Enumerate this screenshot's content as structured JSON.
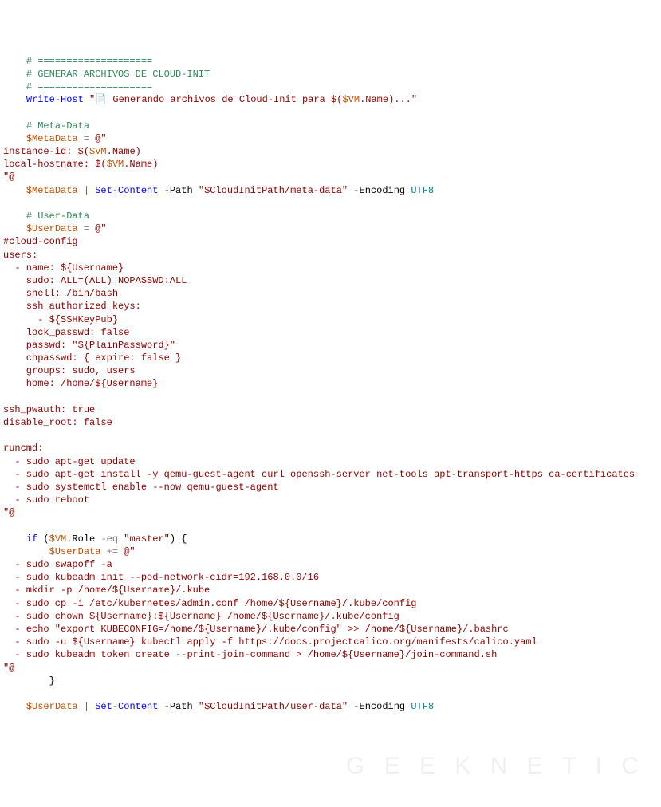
{
  "lines": {
    "sep": "# ====================",
    "title": "# GENERAR ARCHIVOS DE CLOUD-INIT",
    "write_host_cmd": "Write-Host",
    "write_host_str1": "\"",
    "write_host_icon": "📄",
    "write_host_str2": " Generando archivos de Cloud-Init para ",
    "write_host_sub_open": "$(",
    "write_host_var": "$VM",
    "write_host_prop": ".Name",
    "write_host_sub_close": ")",
    "write_host_str3": "...\"",
    "meta_comment": "# Meta-Data",
    "metadata_var": "$MetaData",
    "eq": " = ",
    "heredoc_open": "@\"",
    "inst_id_label": "instance-id: ",
    "local_host_label": "local-hostname: ",
    "heredoc_close": "\"@",
    "pipe": " | ",
    "set_content": "Set-Content",
    "path_flag": " -Path ",
    "meta_path_str": "\"$CloudInitPath/meta-data\"",
    "encoding_flag": " -Encoding ",
    "utf8": "UTF8",
    "user_comment": "# User-Data",
    "userdata_var": "$UserData",
    "cloud_config": "#cloud-config",
    "users_key": "users:",
    "name_line": "  - name: ${Username}",
    "sudo_line": "    sudo: ALL=(ALL) NOPASSWD:ALL",
    "shell_line": "    shell: /bin/bash",
    "ssh_keys_line": "    ssh_authorized_keys:",
    "ssh_key_item": "      - ${SSHKeyPub}",
    "lock_line": "    lock_passwd: false",
    "passwd_line": "    passwd: \"${PlainPassword}\"",
    "chpasswd_line": "    chpasswd: { expire: false }",
    "groups_line": "    groups: sudo, users",
    "home_line": "    home: /home/${Username}",
    "ssh_pwauth": "ssh_pwauth: true",
    "disable_root": "disable_root: false",
    "runcmd_key": "runcmd:",
    "run1": "  - sudo apt-get update",
    "run2": "  - sudo apt-get install -y qemu-guest-agent curl openssh-server net-tools apt-transport-https ca-certificates",
    "run3": "  - sudo systemctl enable --now qemu-guest-agent",
    "run4": "  - sudo reboot",
    "if_kw": "if",
    "if_open": " (",
    "if_var": "$VM",
    "if_prop": ".Role",
    "if_op": " -eq ",
    "if_str": "\"master\"",
    "if_close": ") {",
    "userdata_plus": "$UserData",
    "pluseq": " += ",
    "m1": "  - sudo swapoff -a",
    "m2": "  - sudo kubeadm init --pod-network-cidr=192.168.0.0/16",
    "m3": "  - mkdir -p /home/${Username}/.kube",
    "m4": "  - sudo cp -i /etc/kubernetes/admin.conf /home/${Username}/.kube/config",
    "m5": "  - sudo chown ${Username}:${Username} /home/${Username}/.kube/config",
    "m6": "  - echo \"export KUBECONFIG=/home/${Username}/.kube/config\" >> /home/${Username}/.bashrc",
    "m7": "  - sudo -u ${Username} kubectl apply -f https://docs.projectcalico.org/manifests/calico.yaml",
    "m8": "  - sudo kubeadm token create --print-join-command > /home/${Username}/join-command.sh",
    "closebrace": "}",
    "user_path_str": "\"$CloudInitPath/user-data\""
  },
  "indent": {
    "i4": "    ",
    "i8": "        "
  },
  "watermark": "G E E K N E T I C"
}
